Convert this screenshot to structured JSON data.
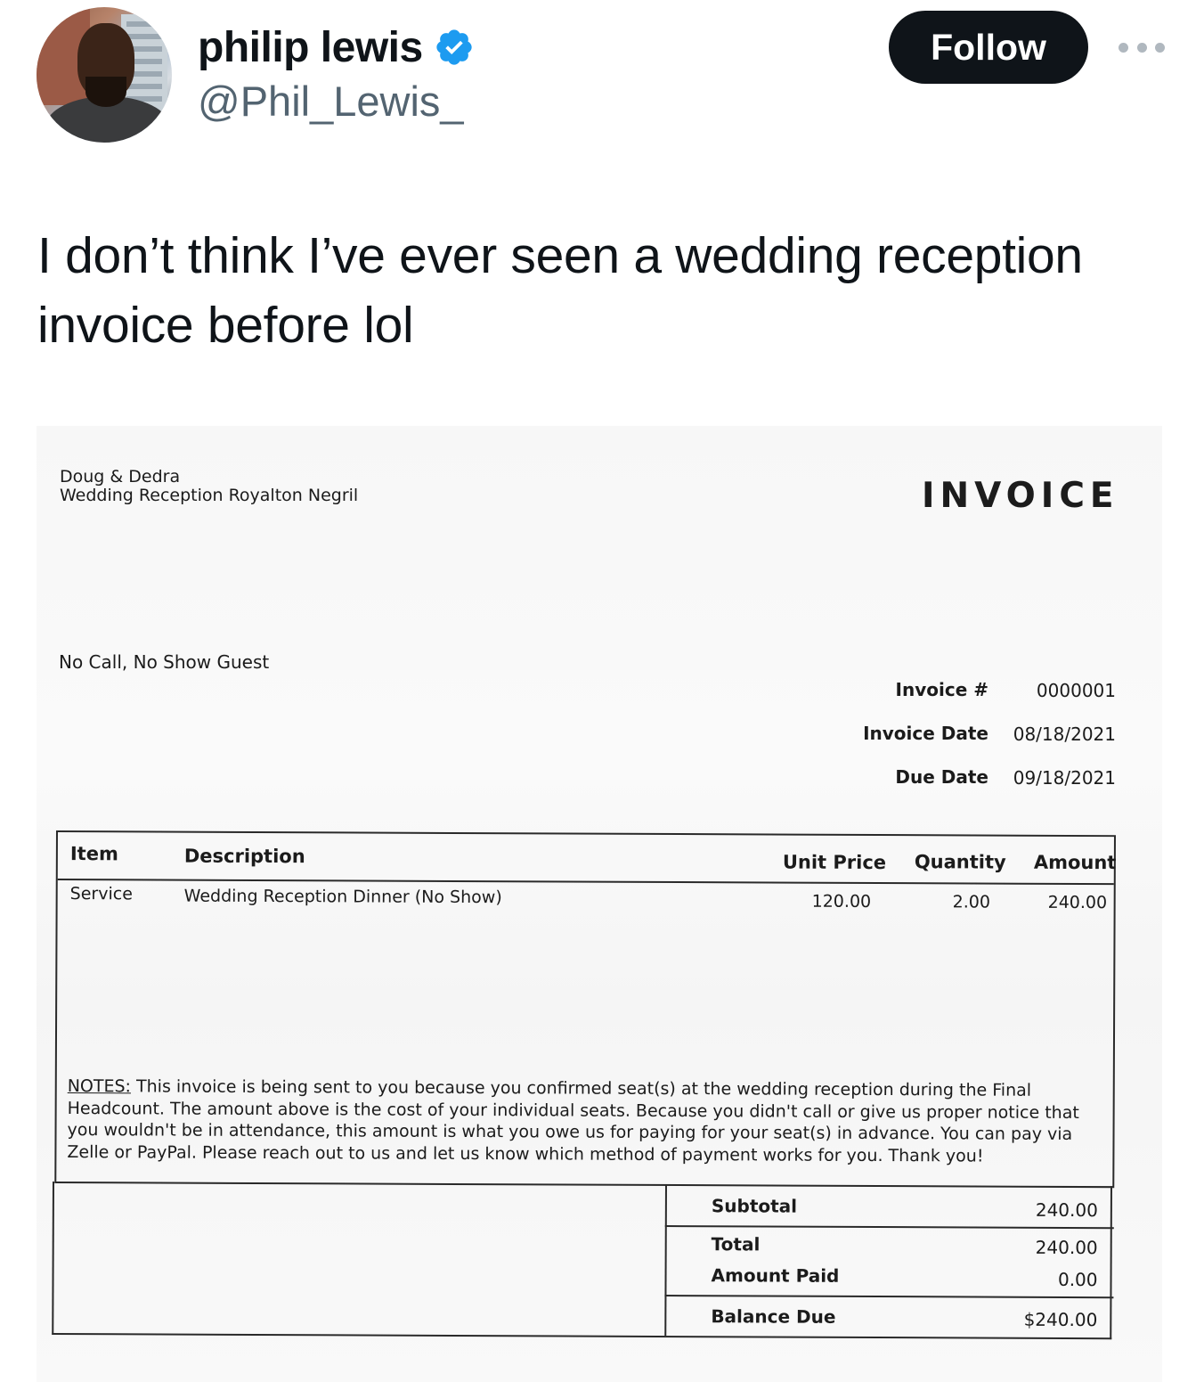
{
  "tweet": {
    "author_name": "philip lewis",
    "handle": "@Phil_Lewis_",
    "follow_label": "Follow",
    "text": "I don’t think I’ve ever seen a wedding reception invoice before lol"
  },
  "colors": {
    "verified_badge": "#1d9bf0",
    "follow_button_bg": "#0f1419",
    "handle_gray": "#536471"
  },
  "icons": {
    "verified": "verified-badge-icon",
    "more": "more-options-icon"
  },
  "invoice": {
    "from_name": "Doug & Dedra",
    "from_event": "Wedding Reception Royalton Negril",
    "title": "INVOICE",
    "bill_to": "No Call, No Show Guest",
    "meta": {
      "number_label": "Invoice #",
      "number_value": "0000001",
      "date_label": "Invoice Date",
      "date_value": "08/18/2021",
      "due_label": "Due Date",
      "due_value": "09/18/2021"
    },
    "columns": {
      "item": "Item",
      "description": "Description",
      "unit_price": "Unit Price",
      "quantity": "Quantity",
      "amount": "Amount"
    },
    "rows": [
      {
        "item": "Service",
        "description": "Wedding Reception Dinner (No Show)",
        "unit_price": "120.00",
        "quantity": "2.00",
        "amount": "240.00"
      }
    ],
    "notes_label": "NOTES:",
    "notes_text": "This invoice is being sent to you because you confirmed seat(s) at the wedding reception during the Final Headcount. The amount above is the cost of your individual seats. Because you didn't call or give us proper notice that you wouldn't be in attendance, this amount is what you owe us for paying for your seat(s) in advance. You can pay via Zelle or PayPal. Please reach out to us and let us know which method of payment works for you. Thank you!",
    "totals": {
      "subtotal_label": "Subtotal",
      "subtotal_value": "240.00",
      "total_label": "Total",
      "total_value": "240.00",
      "paid_label": "Amount Paid",
      "paid_value": "0.00",
      "balance_label": "Balance Due",
      "balance_value": "$240.00"
    }
  }
}
